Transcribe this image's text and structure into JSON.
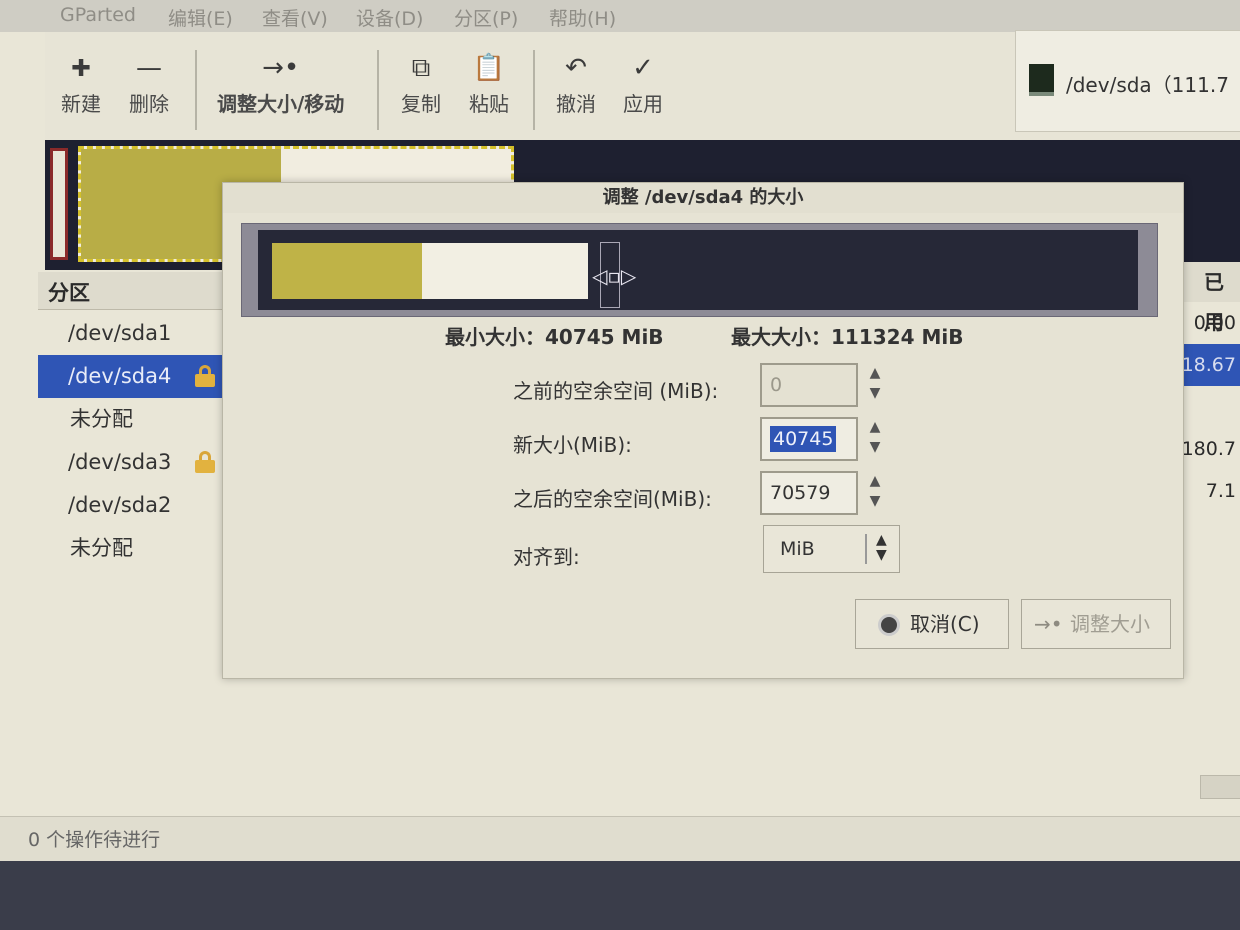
{
  "menubar": {
    "app": "GParted",
    "items": [
      "编辑(E)",
      "查看(V)",
      "设备(D)",
      "分区(P)",
      "帮助(H)"
    ]
  },
  "toolbar": {
    "new_label": "新建",
    "delete_label": "删除",
    "resize_move_label": "调整大小/移动",
    "copy_label": "复制",
    "paste_label": "粘贴",
    "undo_label": "撤消",
    "apply_label": "应用"
  },
  "device_selector": {
    "label": "/dev/sda（111.7"
  },
  "partition_list": {
    "header": "分区",
    "rows": [
      {
        "name": "/dev/sda1",
        "locked": false
      },
      {
        "name": "/dev/sda4",
        "locked": true
      },
      {
        "name": "未分配",
        "locked": false
      },
      {
        "name": "/dev/sda3",
        "locked": true
      },
      {
        "name": "/dev/sda2",
        "locked": false
      },
      {
        "name": "未分配",
        "locked": false
      }
    ]
  },
  "used_column": {
    "header": "已用",
    "values": [
      "0.00",
      "18.67",
      "",
      "180.7",
      "7.1"
    ]
  },
  "dialog": {
    "title": "调整 /dev/sda4 的大小",
    "min_size": "最小大小：40745 MiB",
    "max_size": "最大大小：111324 MiB",
    "free_before_label": "之前的空余空间 (MiB):",
    "free_before_value": "0",
    "new_size_label": "新大小(MiB):",
    "new_size_value": "40745",
    "free_after_label": "之后的空余空间(MiB):",
    "free_after_value": "70579",
    "align_label": "对齐到:",
    "align_value": "MiB",
    "cancel_label": "取消(C)",
    "resize_label": "调整大小"
  },
  "statusbar": {
    "text": "0 个操作待进行"
  },
  "colors": {
    "selection": "#2f55b5",
    "partition_used": "#bfb347",
    "graph_background": "#262837",
    "lock": "#e2b23f"
  }
}
